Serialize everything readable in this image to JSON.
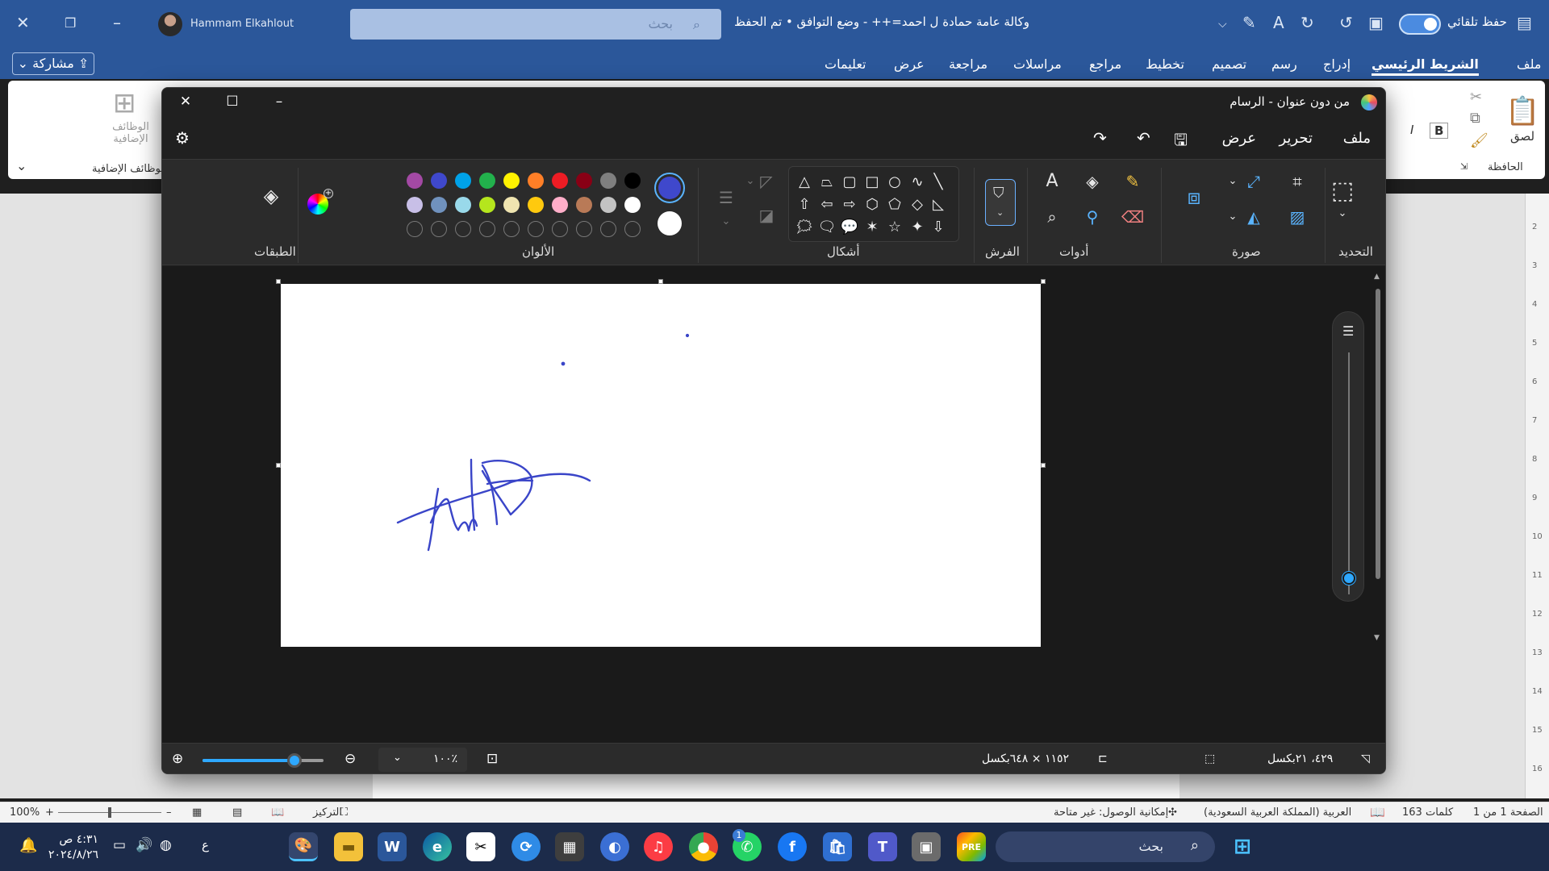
{
  "word": {
    "title": "وكالة عامة حمادة ل احمد=++ - وضع التوافق • تم الحفظ",
    "autosave_label": "حفظ تلقائي",
    "search_placeholder": "بحث",
    "user_name": "Hammam Elkahlout",
    "share_label": "مشاركة",
    "tabs": [
      "ملف",
      "الشريط الرئيسي",
      "إدراج",
      "رسم",
      "تصميم",
      "تخطيط",
      "مراجع",
      "مراسلات",
      "مراجعة",
      "عرض",
      "تعليمات"
    ],
    "active_tab": "الشريط الرئيسي",
    "ribbon": {
      "paste_label": "لصق",
      "clipboard_label": "الحافظة",
      "addins_label": "الوظائف الإضافية",
      "addins_group_label": "الوظائف الإضافية",
      "bold_label": "B",
      "italic_label": "I"
    },
    "ruler_numbers": [
      "2",
      "3",
      "4",
      "5",
      "6",
      "7",
      "8",
      "9",
      "10",
      "11",
      "12",
      "13",
      "14",
      "15",
      "16"
    ],
    "status": {
      "page": "الصفحة 1 من 1",
      "words": "163 كلمات",
      "language": "العربية (المملكة العربية السعودية)",
      "accessibility": "إمكانية الوصول: غير متاحة",
      "focus": "التركيز",
      "zoom": "100%"
    }
  },
  "paint": {
    "title": "من دون عنوان - الرسام",
    "menus": [
      "ملف",
      "تحرير",
      "عرض"
    ],
    "groups": {
      "selection": "التحديد",
      "image": "صورة",
      "tools": "أدوات",
      "brushes": "الفرش",
      "shapes": "أشكال",
      "colors": "الألوان",
      "layers": "الطبقات"
    },
    "colors": {
      "primary": "#3f48cc",
      "secondary": "#ffffff",
      "row1": [
        "#000000",
        "#7f7f7f",
        "#880015",
        "#ed1c24",
        "#ff7f27",
        "#fff200",
        "#22b14c",
        "#00a2e8",
        "#3f48cc",
        "#a349a4"
      ],
      "row2": [
        "#ffffff",
        "#c3c3c3",
        "#b97a57",
        "#ffaec9",
        "#ffc90e",
        "#efe4b0",
        "#b5e61d",
        "#99d9ea",
        "#7092be",
        "#c8bfe7"
      ]
    },
    "stroke_color": "#3a45c8",
    "status": {
      "cursor_position": "٤٢٩، ٢١بكسل",
      "canvas_size": "١١٥٢ × ٦٤٨بكسل",
      "zoom": "١٠٠٪",
      "zoom_fraction": 0.76
    }
  },
  "taskbar": {
    "search_placeholder": "بحث",
    "time": "٤:٣١ ص",
    "date": "٢٠٢٤/٨/٢٦",
    "lang": "ع",
    "whatsapp_badge": "1",
    "apps": [
      "paint",
      "file-explorer",
      "word",
      "edge",
      "capcut",
      "sync",
      "calculator",
      "photos",
      "itunes",
      "chrome",
      "whatsapp",
      "facebook",
      "store",
      "teams",
      "copilot",
      "powerpoint-pre"
    ]
  }
}
